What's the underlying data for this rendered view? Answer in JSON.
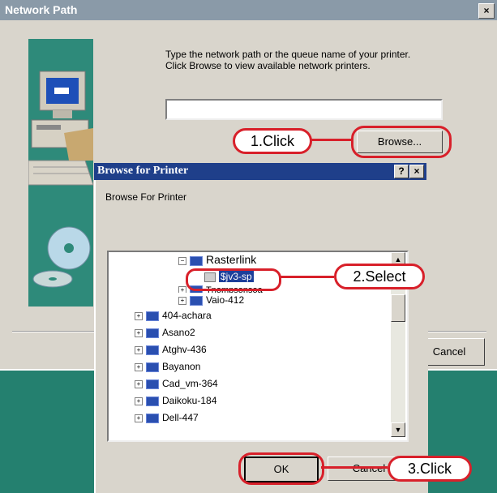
{
  "main_window": {
    "title": "Network Path",
    "close_glyph": "×",
    "instructions_line1": "Type the network path or the queue name of your printer.",
    "instructions_line2": "Click Browse to view available network printers.",
    "path_value": "",
    "browse_label": "Browse...",
    "cancel_label": "Cancel"
  },
  "dialog": {
    "title": "Browse for Printer",
    "help_glyph": "?",
    "close_glyph": "×",
    "label": "Browse For Printer",
    "tree": [
      {
        "label": "Rasterlink",
        "state": "expanded"
      },
      {
        "label": "$jv3-sp",
        "state": "selected"
      },
      {
        "label": "Tnompsonsoa",
        "state": "collapsed"
      },
      {
        "label": "Vaio-412",
        "state": "collapsed"
      },
      {
        "label": "404-achara",
        "state": "collapsed"
      },
      {
        "label": "Asano2",
        "state": "collapsed"
      },
      {
        "label": "Atghv-436",
        "state": "collapsed"
      },
      {
        "label": "Bayanon",
        "state": "collapsed"
      },
      {
        "label": "Cad_vm-364",
        "state": "collapsed"
      },
      {
        "label": "Daikoku-184",
        "state": "collapsed"
      },
      {
        "label": "Dell-447",
        "state": "collapsed"
      }
    ],
    "ok_label": "OK",
    "cancel_label": "Cancel"
  },
  "callouts": {
    "step1": "1.Click",
    "step2": "2.Select",
    "step3": "3.Click"
  },
  "colors": {
    "callout_red": "#d8202a",
    "title_blue": "#1f3f8a",
    "desktop_teal": "#24806f"
  }
}
